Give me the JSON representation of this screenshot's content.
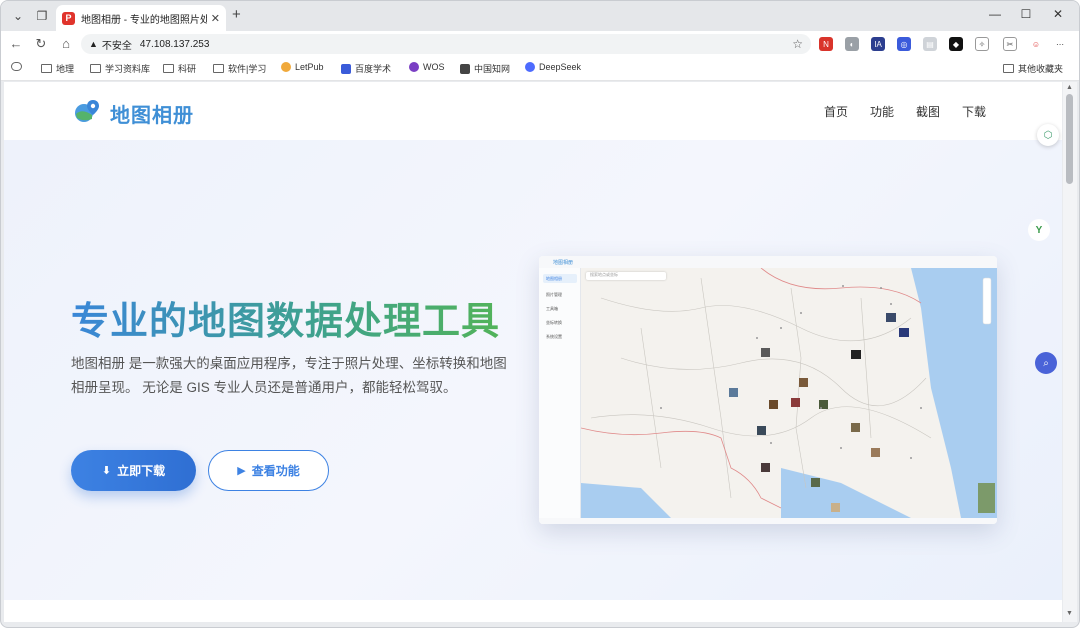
{
  "browser": {
    "tab_title": "地图相册 - 专业的地图照片处理工",
    "tab_favicon": "P",
    "url_warning": "不安全",
    "url": "47.108.137.253"
  },
  "bookmarks": [
    "地理",
    "学习资料库",
    "科研",
    "软件|学习",
    "LetPub",
    "百度学术",
    "WOS",
    "中国知网",
    "DeepSeek"
  ],
  "bookmarks_other": "其他收藏夹",
  "site": {
    "logo_text": "地图相册",
    "nav": [
      "首页",
      "功能",
      "截图",
      "下载"
    ]
  },
  "hero": {
    "title": "专业的地图数据处理工具",
    "description": "地图相册 是一款强大的桌面应用程序，专注于照片处理、坐标转换和地图相册呈现。 无论是 GIS 专业人员还是普通用户，都能轻松驾驭。",
    "primary_button": "立即下载",
    "secondary_button": "查看功能"
  },
  "preview": {
    "app_title": "地图相册",
    "search_placeholder": "搜索地点或坐标",
    "sidebar_items": [
      "地图相册",
      "照片管理",
      "工具箱",
      "坐标转换",
      "系统设置"
    ]
  },
  "colors": {
    "brand_blue": "#3d82e3",
    "brand_green": "#52b35a",
    "hero_bg": "#eef2fb"
  }
}
